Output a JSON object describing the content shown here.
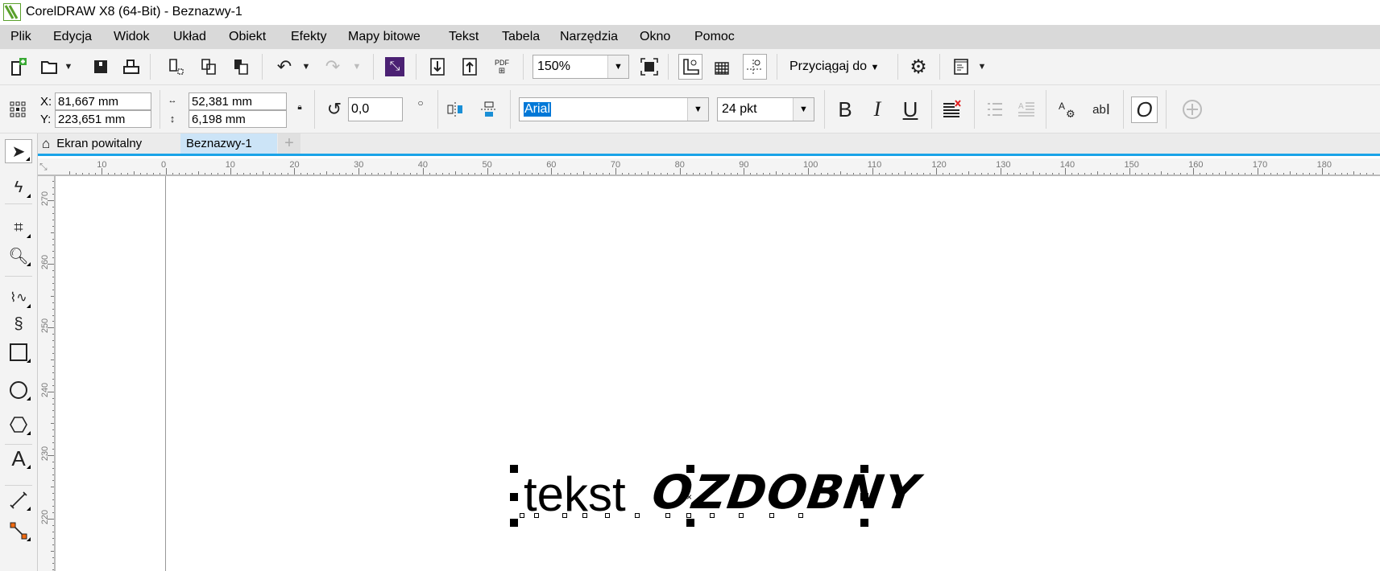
{
  "window": {
    "title": "CorelDRAW X8 (64-Bit) - Beznazwy-1"
  },
  "menu": [
    "Plik",
    "Edycja",
    "Widok",
    "Układ",
    "Obiekt",
    "Efekty",
    "Mapy bitowe",
    "Tekst",
    "Tabela",
    "Narzędzia",
    "Okno",
    "Pomoc"
  ],
  "toolbar": {
    "zoom": "150%",
    "snap_label": "Przyciągaj do",
    "pdf_label": "PDF"
  },
  "properties": {
    "x_label": "X:",
    "y_label": "Y:",
    "x": "81,667 mm",
    "y": "223,651 mm",
    "width": "52,381 mm",
    "height": "6,198 mm",
    "rotation": "0,0",
    "font": "Arial",
    "font_size": "24 pkt",
    "bold": "B",
    "italic": "I",
    "underline": "U",
    "ab_label": "ab"
  },
  "tabs": [
    {
      "label": "Ekran powitalny"
    },
    {
      "label": "Beznazwy-1",
      "active": true
    }
  ],
  "ruler": {
    "h_labels": [
      "10",
      "0",
      "10",
      "20",
      "30",
      "40",
      "50",
      "60",
      "70",
      "80",
      "90",
      "100",
      "110",
      "120",
      "130",
      "140",
      "150",
      "160",
      "170",
      "180"
    ],
    "v_labels": [
      "270",
      "260",
      "250",
      "240",
      "230",
      "220"
    ]
  },
  "document": {
    "text_plain": "tekst",
    "text_decorative": "OZDOBNY"
  },
  "colors": {
    "accent": "#1aa3e8",
    "menubar": "#d9d9d9",
    "selection": "#0078d7"
  }
}
